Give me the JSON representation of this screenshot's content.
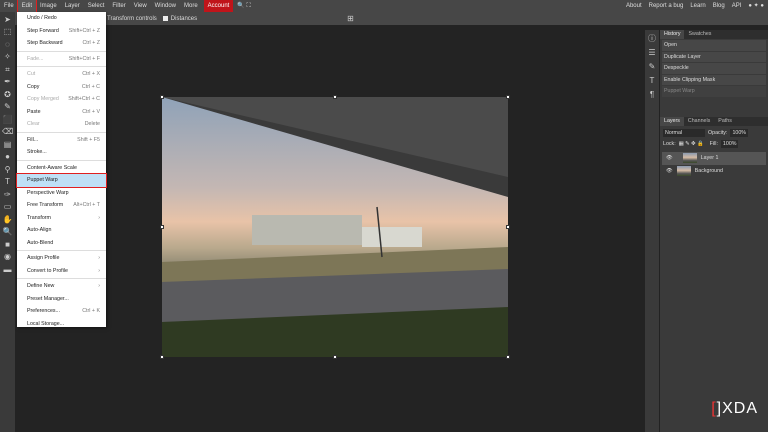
{
  "menubar": {
    "items": [
      "File",
      "Edit",
      "Image",
      "Layer",
      "Select",
      "Filter",
      "View",
      "Window",
      "More"
    ],
    "account": "Account",
    "links": [
      "About",
      "Report a bug",
      "Learn",
      "Blog",
      "API"
    ]
  },
  "options": {
    "transform_controls": "Transform controls",
    "distances": "Distances"
  },
  "edit_menu": {
    "items": [
      {
        "label": "Undo / Redo",
        "shortcut": "",
        "disabled": false
      },
      {
        "label": "Step Forward",
        "shortcut": "Shift+Ctrl + Z",
        "disabled": false
      },
      {
        "label": "Step Backward",
        "shortcut": "Ctrl + Z",
        "disabled": false
      },
      {
        "sep": true
      },
      {
        "label": "Fade...",
        "shortcut": "Shift+Ctrl + F",
        "disabled": true
      },
      {
        "sep": true
      },
      {
        "label": "Cut",
        "shortcut": "Ctrl + X",
        "disabled": true
      },
      {
        "label": "Copy",
        "shortcut": "Ctrl + C",
        "disabled": false
      },
      {
        "label": "Copy Merged",
        "shortcut": "Shift+Ctrl + C",
        "disabled": true
      },
      {
        "label": "Paste",
        "shortcut": "Ctrl + V",
        "disabled": false
      },
      {
        "label": "Clear",
        "shortcut": "Delete",
        "disabled": true
      },
      {
        "sep": true
      },
      {
        "label": "Fill...",
        "shortcut": "Shift + F5",
        "disabled": false
      },
      {
        "label": "Stroke...",
        "shortcut": "",
        "disabled": false
      },
      {
        "sep": true
      },
      {
        "label": "Content-Aware Scale",
        "shortcut": "",
        "disabled": false
      },
      {
        "label": "Puppet Warp",
        "shortcut": "",
        "disabled": false,
        "highlight": true
      },
      {
        "label": "Perspective Warp",
        "shortcut": "",
        "disabled": false
      },
      {
        "label": "Free Transform",
        "shortcut": "Alt+Ctrl + T",
        "disabled": false
      },
      {
        "label": "Transform",
        "shortcut": "›",
        "disabled": false
      },
      {
        "label": "Auto-Align",
        "shortcut": "",
        "disabled": false
      },
      {
        "label": "Auto-Blend",
        "shortcut": "",
        "disabled": false
      },
      {
        "sep": true
      },
      {
        "label": "Assign Profile",
        "shortcut": "›",
        "disabled": false
      },
      {
        "label": "Convert to Profile",
        "shortcut": "›",
        "disabled": false
      },
      {
        "sep": true
      },
      {
        "label": "Define New",
        "shortcut": "›",
        "disabled": false
      },
      {
        "label": "Preset Manager...",
        "shortcut": "",
        "disabled": false
      },
      {
        "label": "Preferences...",
        "shortcut": "Ctrl + K",
        "disabled": false
      },
      {
        "label": "Local Storage...",
        "shortcut": "",
        "disabled": false
      }
    ]
  },
  "history": {
    "tabs": [
      "History",
      "Swatches"
    ],
    "items": [
      "Open",
      "Duplicate Layer",
      "Despeckle",
      "Enable Clipping Mask",
      "Puppet Warp"
    ]
  },
  "layers": {
    "tabs": [
      "Layers",
      "Channels",
      "Paths"
    ],
    "blend": "Normal",
    "opacity_label": "Opacity:",
    "opacity": "100%",
    "lock_label": "Lock:",
    "fill_label": "Fill:",
    "fill": "100%",
    "items": [
      "Layer 1",
      "Background"
    ]
  },
  "watermark": "XDA"
}
